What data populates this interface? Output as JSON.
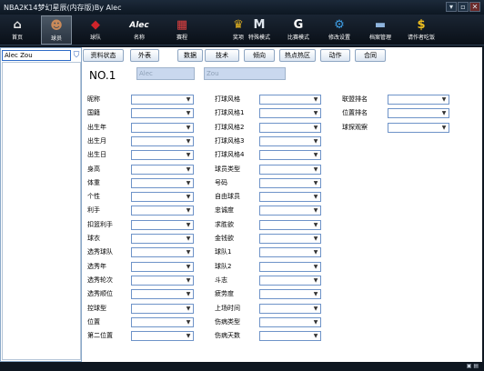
{
  "window": {
    "title": "NBA2K14梦幻星辰(内存版)By Alec",
    "min_label": "▾",
    "max_label": "▫",
    "close_label": "✕"
  },
  "toolbar": {
    "items": [
      {
        "label": "首页",
        "icon": "home-icon",
        "glyph": "⌂",
        "color": "#e8e8e8"
      },
      {
        "label": "球员",
        "icon": "player-icon",
        "glyph": "☻",
        "color": "#c98a5a"
      },
      {
        "label": "球队",
        "icon": "team-icon",
        "glyph": "◆",
        "color": "#d0242b"
      },
      {
        "label": "名称",
        "icon": "name-icon",
        "glyph": "Alec",
        "color": "#ffffff"
      },
      {
        "label": "赛程",
        "icon": "calendar-icon",
        "glyph": "▦",
        "color": "#e04040"
      },
      {
        "label": "奖项",
        "icon": "trophy-icon",
        "glyph": "♛",
        "color": "#e0b020"
      },
      {
        "label": "特殊模式",
        "icon": "mode-icon",
        "glyph": "M",
        "color": "#dfe6ee"
      },
      {
        "label": "比赛模式",
        "icon": "gatorade-icon",
        "glyph": "G",
        "color": "#ffffff"
      },
      {
        "label": "修改设置",
        "icon": "gear-icon",
        "glyph": "⚙",
        "color": "#3fa0e8"
      },
      {
        "label": "档案管理",
        "icon": "archive-icon",
        "glyph": "▬",
        "color": "#8fb5de"
      },
      {
        "label": "请作者吃饭",
        "icon": "dollar-icon",
        "glyph": "$",
        "color": "#f0c020"
      }
    ]
  },
  "sidebar": {
    "search_value": "Alec Zou",
    "filter_icon": "filter-icon"
  },
  "tabs": [
    "资料状态",
    "外表",
    "数据",
    "技术",
    "倾向",
    "热点热区",
    "动作",
    "合同"
  ],
  "player": {
    "number_label": "NO.1",
    "first_name": "Alec",
    "last_name": "Zou"
  },
  "fields": {
    "col1": [
      "昵称",
      "国籍",
      "出生年",
      "出生月",
      "出生日",
      "身高",
      "体重",
      "个性",
      "利手",
      "扣篮利手",
      "球衣",
      "选秀球队",
      "选秀年",
      "选秀轮次",
      "选秀顺位",
      "控球型",
      "位置",
      "第二位置"
    ],
    "col2": [
      "打球风格",
      "打球风格1",
      "打球风格2",
      "打球风格3",
      "打球风格4",
      "球员类型",
      "号码",
      "自由球员",
      "忠诚度",
      "求胜欲",
      "金钱欲",
      "球队1",
      "球队2",
      "斗志",
      "疲劳度",
      "上场时间",
      "伤病类型",
      "伤病天数"
    ],
    "col3": [
      "联盟排名",
      "位置排名",
      "球探观察"
    ]
  },
  "colors": {
    "select_border": "#6e93c8",
    "name_box": "#c9d8ee",
    "toolbar_bg": "#0d1620"
  },
  "status": {
    "icons": "▣ ▤"
  }
}
